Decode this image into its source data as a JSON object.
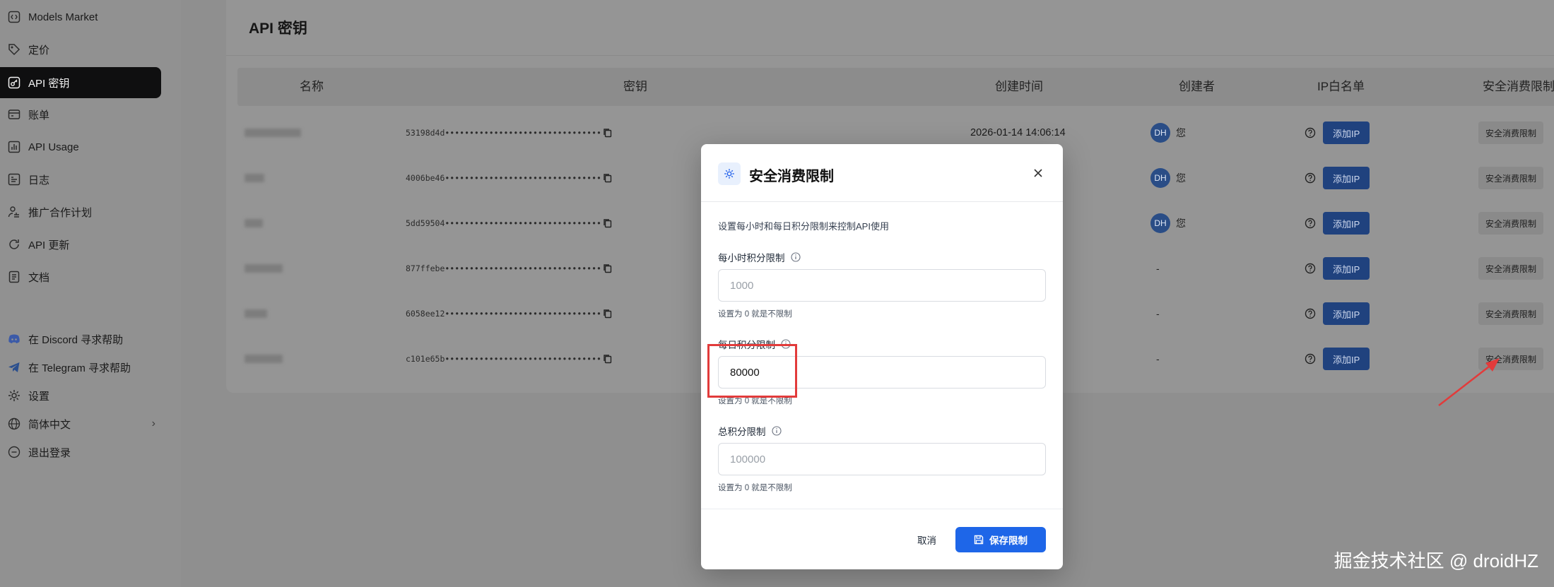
{
  "sidebar": {
    "items": [
      {
        "label": "Models Market",
        "icon": "code-box-icon"
      },
      {
        "label": "定价",
        "icon": "price-tag-icon"
      },
      {
        "label": "API 密钥",
        "icon": "key-icon",
        "active": true
      },
      {
        "label": "账单",
        "icon": "wallet-icon"
      },
      {
        "label": "API Usage",
        "icon": "bar-chart-icon"
      },
      {
        "label": "日志",
        "icon": "log-icon"
      },
      {
        "label": "推广合作计划",
        "icon": "handshake-icon"
      },
      {
        "label": "API 更新",
        "icon": "refresh-icon"
      },
      {
        "label": "文档",
        "icon": "document-icon"
      }
    ],
    "bottom": [
      {
        "label": "在 Discord 寻求帮助",
        "icon": "discord-icon"
      },
      {
        "label": "在 Telegram 寻求帮助",
        "icon": "telegram-icon"
      },
      {
        "label": "设置",
        "icon": "gear-icon"
      },
      {
        "label": "简体中文",
        "icon": "globe-icon"
      },
      {
        "label": "退出登录",
        "icon": "logout-icon"
      }
    ]
  },
  "page": {
    "title": "API 密钥"
  },
  "table": {
    "headers": [
      "名称",
      "密钥",
      "创建时间",
      "创建者",
      "IP白名单",
      "安全消费限制"
    ],
    "rows": [
      {
        "key": "53198d4d••••••••••••••••••••••••••••••••",
        "created": "2026-01-14 14:06:14",
        "avatar": "DH",
        "creator": "您",
        "ip_label": "添加IP",
        "limit_label": "安全消费限制"
      },
      {
        "key": "4006be46••••••••••••••••••••••••••••••••",
        "created": "",
        "avatar": "DH",
        "creator": "您",
        "ip_label": "添加IP",
        "limit_label": "安全消费限制"
      },
      {
        "key": "5dd59504••••••••••••••••••••••••••••••••",
        "created": "",
        "avatar": "DH",
        "creator": "您",
        "ip_label": "添加IP",
        "limit_label": "安全消费限制"
      },
      {
        "key": "877ffebe••••••••••••••••••••••••••••••••",
        "created": "",
        "avatar": "",
        "creator": "-",
        "ip_label": "添加IP",
        "limit_label": "安全消费限制"
      },
      {
        "key": "6058ee12••••••••••••••••••••••••••••••••",
        "created": "",
        "avatar": "",
        "creator": "-",
        "ip_label": "添加IP",
        "limit_label": "安全消费限制"
      },
      {
        "key": "c101e65b••••••••••••••••••••••••••••••••",
        "created": "",
        "avatar": "",
        "creator": "-",
        "ip_label": "添加IP",
        "limit_label": "安全消费限制"
      }
    ]
  },
  "modal": {
    "title": "安全消费限制",
    "description": "设置每小时和每日积分限制来控制API使用",
    "hourly": {
      "label": "每小时积分限制",
      "value": "",
      "placeholder": "1000",
      "help": "设置为 0 就是不限制"
    },
    "daily": {
      "label": "每日积分限制",
      "value": "80000",
      "placeholder": "",
      "help": "设置为 0 就是不限制"
    },
    "total": {
      "label": "总积分限制",
      "value": "",
      "placeholder": "100000",
      "help": "设置为 0 就是不限制"
    },
    "cancel_label": "取消",
    "save_label": "保存限制"
  },
  "watermark": "掘金技术社区 @ droidHZ",
  "colors": {
    "primary": "#1e66e8",
    "annotation": "#e23b3b",
    "active_nav": "#0f0f10"
  }
}
